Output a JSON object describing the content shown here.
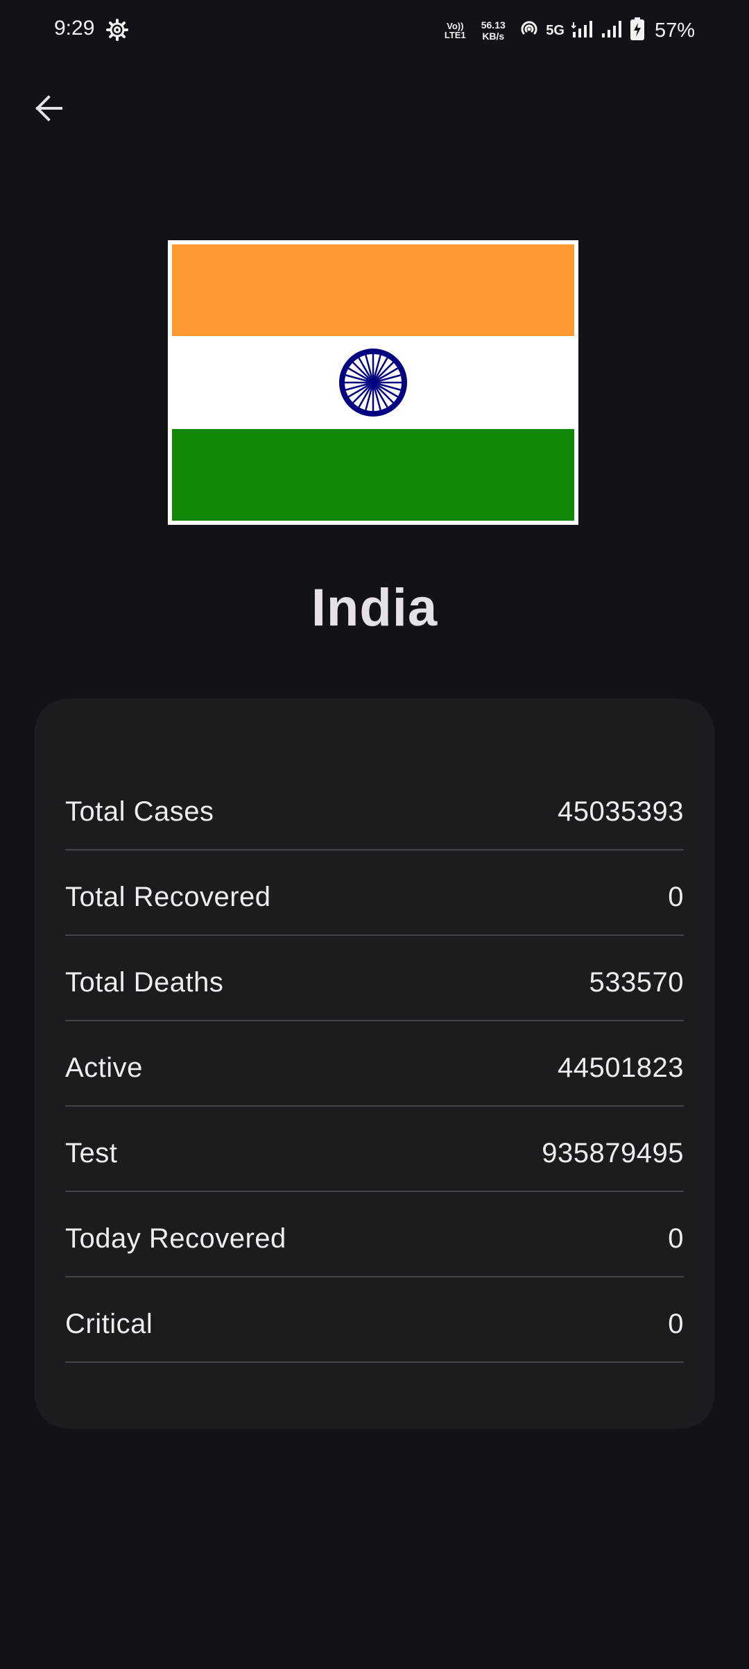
{
  "status_bar": {
    "time": "9:29",
    "volte_line1": "Vo))",
    "volte_line2": "LTE1",
    "speed_value": "56.13",
    "speed_unit": "KB/s",
    "network": "5G",
    "battery": "57%",
    "icons": [
      "settings-gear-icon",
      "hotspot-icon",
      "signal-icon",
      "battery-charging-icon"
    ]
  },
  "header": {
    "back_icon": "arrow-left-icon"
  },
  "country": {
    "name": "India",
    "flag_colors": {
      "saffron": "#FF9933",
      "white": "#FFFFFF",
      "green": "#138808",
      "chakra": "#000080"
    }
  },
  "stats": [
    {
      "label": "Total Cases",
      "value": "45035393"
    },
    {
      "label": "Total Recovered",
      "value": "0"
    },
    {
      "label": "Total Deaths",
      "value": "533570"
    },
    {
      "label": "Active",
      "value": "44501823"
    },
    {
      "label": "Test",
      "value": "935879495"
    },
    {
      "label": "Today Recovered",
      "value": "0"
    },
    {
      "label": "Critical",
      "value": "0"
    }
  ]
}
